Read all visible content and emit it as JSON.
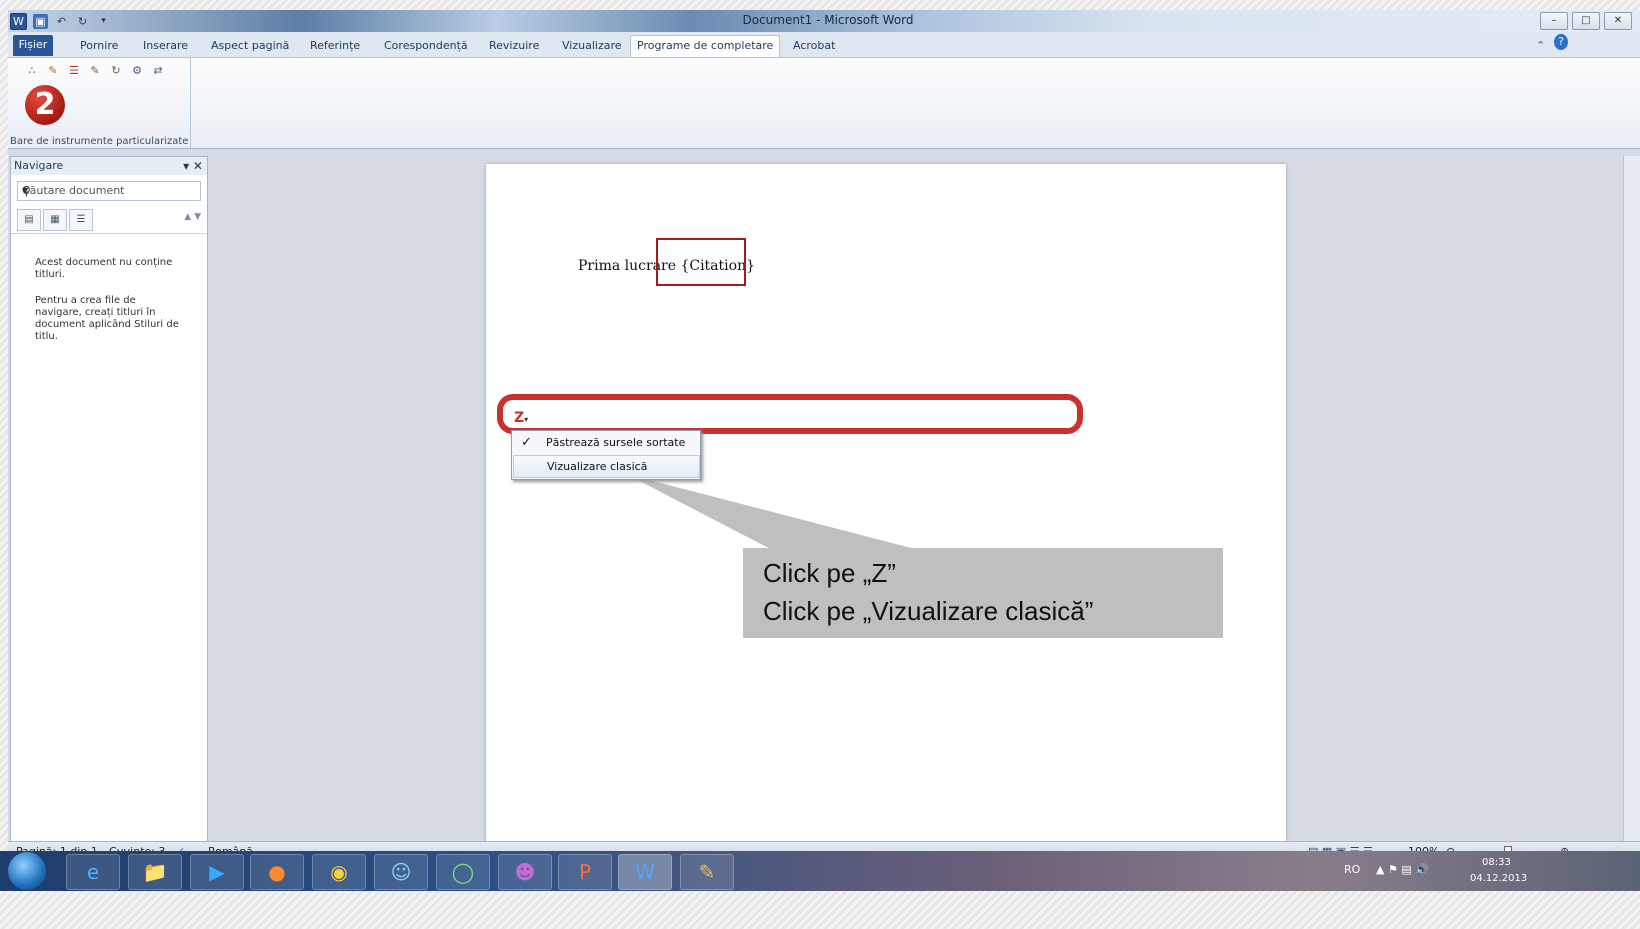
{
  "window": {
    "title": "Document1 - Microsoft Word",
    "controls": [
      "–",
      "□",
      "✕"
    ]
  },
  "tabs": {
    "file": "Fișier",
    "items": [
      "Pornire",
      "Inserare",
      "Aspect pagină",
      "Referințe",
      "Corespondență",
      "Revizuire",
      "Vizualizare",
      "Programe de completare",
      "Acrobat"
    ]
  },
  "ribbon": {
    "group_label": "Bare de instrumente particularizate",
    "step_badge": "2"
  },
  "nav": {
    "title": "Navigare",
    "search_placeholder": "Căutare document",
    "msg1": "Acest document nu conține titluri.",
    "msg2": "Pentru a crea file de navigare, creați titluri în document aplicând Stiluri de titlu."
  },
  "document": {
    "paragraph": "Prima lucrare {Citation}"
  },
  "zotero": {
    "button": "Z",
    "menu": [
      {
        "label": "Păstrează sursele sortate",
        "checked": true
      },
      {
        "label": "Vizualizare clasică",
        "checked": false
      }
    ]
  },
  "callout": {
    "line1": "Click pe „Z”",
    "line2": "Click pe „Vizualizare clasică”"
  },
  "status": {
    "page": "Pagină: 1 din 1",
    "words": "Cuvinte: 3",
    "language": "Română",
    "zoom": "100%"
  },
  "taskbar": {
    "lang": "RO",
    "time": "08:33",
    "date": "04.12.2013"
  }
}
